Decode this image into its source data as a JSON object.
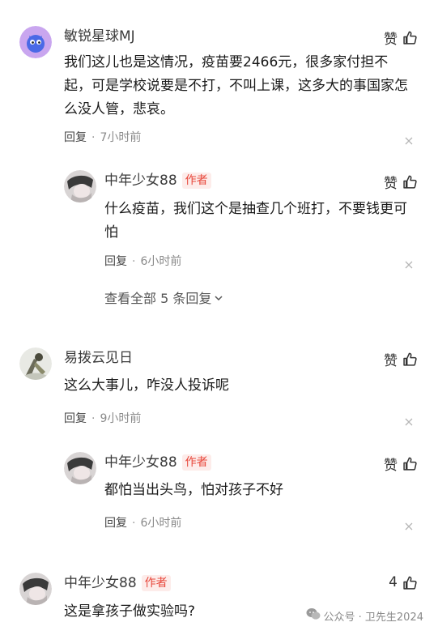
{
  "comments": [
    {
      "user": "敏锐星球MJ",
      "like_label": "赞",
      "text_line1": "我们这儿也是这情况，疫苗要2466元，很多家付担不",
      "text_line2": "起，可是学校说要是不打，不叫上课，这多大的事国家怎",
      "text_line3": "么没人管，悲哀。",
      "reply_label": "回复",
      "time": "7小时前",
      "reply": {
        "user": "中年少女88",
        "author_tag": "作者",
        "like_label": "赞",
        "text_line1": "什么疫苗，我们这个是抽查几个班打，不要钱更可",
        "text_line2": "怕",
        "reply_label": "回复",
        "time": "6小时前"
      },
      "view_more": "查看全部 5 条回复"
    },
    {
      "user": "易拨云见日",
      "like_label": "赞",
      "text_line1": "这么大事儿，咋没人投诉呢",
      "reply_label": "回复",
      "time": "9小时前",
      "reply": {
        "user": "中年少女88",
        "author_tag": "作者",
        "like_label": "赞",
        "text_line1": "都怕当出头鸟，怕对孩子不好",
        "reply_label": "回复",
        "time": "6小时前"
      }
    },
    {
      "user": "中年少女88",
      "author_tag": "作者",
      "like_count": "4",
      "text_line1": "这是拿孩子做实验吗?"
    }
  ],
  "separator": "·",
  "watermark": "公众号 · 卫先生2024",
  "icons": {
    "like": "thumbs-up-icon",
    "close": "close-icon",
    "chevron": "chevron-down-icon",
    "wechat": "wechat-icon"
  },
  "colors": {
    "author_tag_text": "#e8473b",
    "author_tag_bg": "#fdecea",
    "meta_text": "#8a8a8a"
  }
}
